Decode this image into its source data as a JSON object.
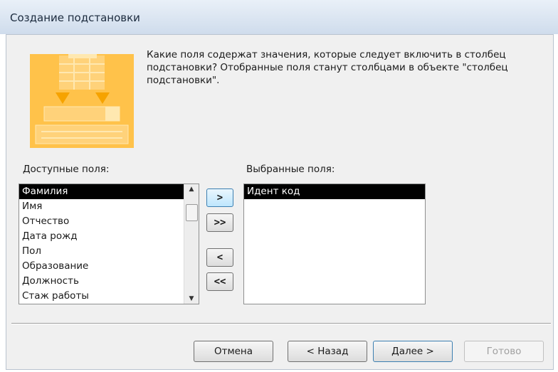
{
  "window": {
    "title": "Создание подстановки"
  },
  "wizard": {
    "question": "Какие поля содержат значения, которые следует включить в столбец подстановки? Отобранные поля станут столбцами в объекте \"столбец подстановки\".",
    "available_label": "Доступные поля:",
    "selected_label": "Выбранные поля:",
    "available_fields": [
      "Фамилия",
      "Имя",
      "Отчество",
      "Дата рожд",
      "Пол",
      "Образование",
      "Должность",
      "Стаж работы"
    ],
    "available_selected_index": 0,
    "selected_fields": [
      "Идент код"
    ],
    "selected_selected_index": 0,
    "move_buttons": {
      "add_one": ">",
      "add_all": ">>",
      "remove_one": "<",
      "remove_all": "<<"
    }
  },
  "footer": {
    "cancel": "Отмена",
    "back": "< Назад",
    "next": "Далее >",
    "finish": "Готово"
  },
  "colors": {
    "icon_bg": "#ffc24a",
    "selection": "#000000",
    "dialog_bg": "#f0f0f0"
  },
  "icons": {
    "wizard_illustration": "lookup-wizard-icon",
    "scroll_up": "scroll-up-arrow-icon",
    "scroll_down": "scroll-down-arrow-icon"
  }
}
